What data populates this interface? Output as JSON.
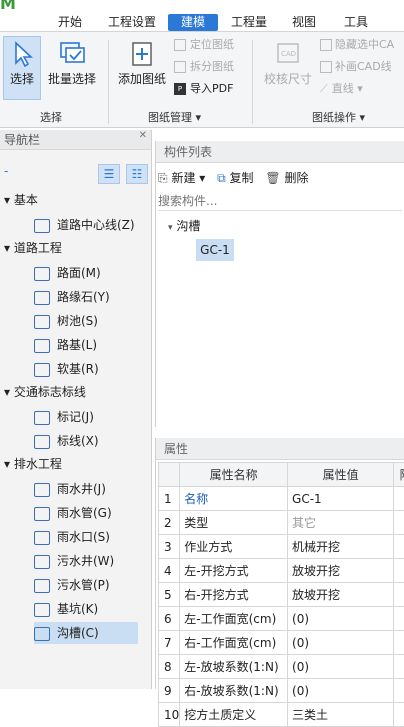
{
  "menu": {
    "tabs": [
      "开始",
      "工程设置",
      "建模",
      "工程量",
      "视图",
      "工具"
    ]
  },
  "ribbon": {
    "select_label": "选择",
    "batch_select_label": "批量选择",
    "add_drawing_label": "添加图纸",
    "locate_drawing_label": "定位图纸",
    "split_drawing_label": "拆分图纸",
    "import_pdf_label": "导入PDF",
    "check_size_label": "校核尺寸",
    "hide_cad_label": "隐藏选中CA",
    "fill_cad_label": "补画CAD线",
    "line_label": "直线",
    "group_select": "选择",
    "group_drawing_mgmt": "图纸管理",
    "group_drawing_ops": "图纸操作"
  },
  "nav": {
    "title": "导航栏",
    "groups": [
      {
        "label": "基本",
        "items": [
          "道路中心线(Z)"
        ]
      },
      {
        "label": "道路工程",
        "items": [
          "路面(M)",
          "路缘石(Y)",
          "树池(S)",
          "路基(L)",
          "软基(R)"
        ]
      },
      {
        "label": "交通标志标线",
        "items": [
          "标记(J)",
          "标线(X)"
        ]
      },
      {
        "label": "排水工程",
        "items": [
          "雨水井(J)",
          "雨水管(G)",
          "雨水口(S)",
          "污水井(W)",
          "污水管(P)",
          "基坑(K)",
          "沟槽(C)"
        ]
      }
    ]
  },
  "components": {
    "title": "构件列表",
    "new_label": "新建",
    "copy_label": "复制",
    "delete_label": "删除",
    "search_placeholder": "搜索构件...",
    "group": "沟槽",
    "item": "GC-1"
  },
  "properties": {
    "title": "属性",
    "headers": [
      "属性名称",
      "属性值",
      "附"
    ],
    "rows": [
      {
        "n": "1",
        "name": "名称",
        "value": "GC-1"
      },
      {
        "n": "2",
        "name": "类型",
        "value": "其它"
      },
      {
        "n": "3",
        "name": "作业方式",
        "value": "机械开挖"
      },
      {
        "n": "4",
        "name": "左-开挖方式",
        "value": "放坡开挖"
      },
      {
        "n": "5",
        "name": "右-开挖方式",
        "value": "放坡开挖"
      },
      {
        "n": "6",
        "name": "左-工作面宽(cm)",
        "value": "(0)"
      },
      {
        "n": "7",
        "name": "右-工作面宽(cm)",
        "value": "(0)"
      },
      {
        "n": "8",
        "name": "左-放坡系数(1:N)",
        "value": "(0)"
      },
      {
        "n": "9",
        "name": "右-放坡系数(1:N)",
        "value": "(0)"
      },
      {
        "n": "10",
        "name": "挖方土质定义",
        "value": "三类土"
      }
    ]
  },
  "colors": {
    "accent": "#2b78d6",
    "selected": "#c9ddf3",
    "link": "#1f5fbf"
  }
}
